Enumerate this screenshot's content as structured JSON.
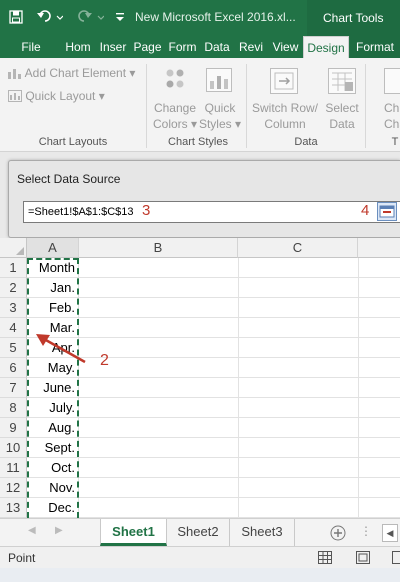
{
  "window": {
    "title": "New Microsoft Excel 2016.xl...",
    "context_label": "Chart Tools"
  },
  "quick_access": {
    "save_icon": "save-icon",
    "undo_icon": "undo-icon",
    "redo_icon": "redo-icon",
    "customize_icon": "customize-icon"
  },
  "tabs": [
    "File",
    "Hom",
    "Inser",
    "Page",
    "Form",
    "Data",
    "Revi",
    "View",
    "Design",
    "Format"
  ],
  "active_tab": "Design",
  "ribbon": {
    "add_chart_element": "Add Chart Element",
    "quick_layout": "Quick Layout",
    "change_colors_1": "Change",
    "change_colors_2": "Colors",
    "quick_styles_1": "Quick",
    "quick_styles_2": "Styles",
    "switch_row_1": "Switch Row/",
    "switch_row_2": "Column",
    "select_data_1": "Select",
    "select_data_2": "Data",
    "cut_1": "Ch",
    "cut_2": "Char",
    "groups": {
      "chart_layouts": "Chart Layouts",
      "chart_styles": "Chart Styles",
      "data": "Data",
      "type": "T"
    }
  },
  "dialog": {
    "title": "Select Data Source",
    "range_value": "=Sheet1!$A$1:$C$13",
    "callout_3": "3",
    "callout_4": "4"
  },
  "columns": [
    "A",
    "B",
    "C"
  ],
  "rows": [
    {
      "num": "1",
      "a": "Month"
    },
    {
      "num": "2",
      "a": "Jan."
    },
    {
      "num": "3",
      "a": "Feb."
    },
    {
      "num": "4",
      "a": "Mar."
    },
    {
      "num": "5",
      "a": "Apr."
    },
    {
      "num": "6",
      "a": "May."
    },
    {
      "num": "7",
      "a": "June."
    },
    {
      "num": "8",
      "a": "July."
    },
    {
      "num": "9",
      "a": "Aug."
    },
    {
      "num": "10",
      "a": "Sept."
    },
    {
      "num": "11",
      "a": "Oct."
    },
    {
      "num": "12",
      "a": "Nov."
    },
    {
      "num": "13",
      "a": "Dec."
    }
  ],
  "annotation": {
    "callout_2": "2"
  },
  "sheets": [
    "Sheet1",
    "Sheet2",
    "Sheet3"
  ],
  "active_sheet": "Sheet1",
  "status": {
    "mode": "Point"
  },
  "colors": {
    "accent": "#217346",
    "callout": "#c0392b"
  }
}
